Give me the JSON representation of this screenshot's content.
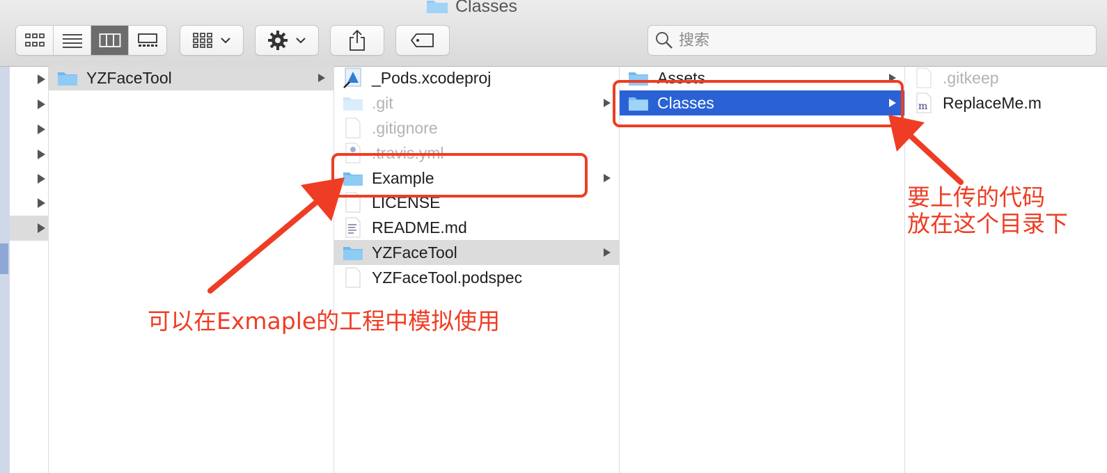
{
  "window": {
    "title": "Classes"
  },
  "toolbar": {
    "view_modes": [
      "icon-view",
      "list-view",
      "column-view",
      "gallery-view"
    ],
    "active_view": "column-view",
    "group_menu": "group-by-icon",
    "action_menu": "gear-icon",
    "share": "share-icon",
    "tag": "tag-icon"
  },
  "search": {
    "placeholder": "搜索",
    "value": ""
  },
  "columns": {
    "root": {
      "items": [
        "YZFaceTool"
      ]
    },
    "project": {
      "items": [
        {
          "name": "_Pods.xcodeproj",
          "kind": "xcodeproj",
          "dim": false
        },
        {
          "name": ".git",
          "kind": "folder",
          "dim": true,
          "has_children": true
        },
        {
          "name": ".gitignore",
          "kind": "file",
          "dim": true
        },
        {
          "name": ".travis.yml",
          "kind": "yml",
          "dim": true
        },
        {
          "name": "Example",
          "kind": "folder",
          "dim": false,
          "has_children": true
        },
        {
          "name": "LICENSE",
          "kind": "file",
          "dim": false
        },
        {
          "name": "README.md",
          "kind": "md",
          "dim": false
        },
        {
          "name": "YZFaceTool",
          "kind": "folder",
          "dim": false,
          "has_children": true,
          "selected": true
        },
        {
          "name": "YZFaceTool.podspec",
          "kind": "file",
          "dim": false
        }
      ]
    },
    "pod": {
      "items": [
        {
          "name": "Assets",
          "kind": "folder",
          "has_children": true
        },
        {
          "name": "Classes",
          "kind": "folder",
          "has_children": true,
          "selected": true
        }
      ]
    },
    "classes": {
      "items": [
        {
          "name": ".gitkeep",
          "kind": "file",
          "dim": true
        },
        {
          "name": "ReplaceMe.m",
          "kind": "objc-m",
          "dim": false
        }
      ]
    }
  },
  "annotations": {
    "note1": "可以在Exmaple的工程中模拟使用",
    "note2_line1": "要上传的代码",
    "note2_line2": "放在这个目录下",
    "color": "#ee3d24"
  },
  "colors": {
    "selection_blue": "#2a62d6",
    "selection_grey": "#dcdcdc",
    "folder_blue": "#7cc2f2"
  }
}
